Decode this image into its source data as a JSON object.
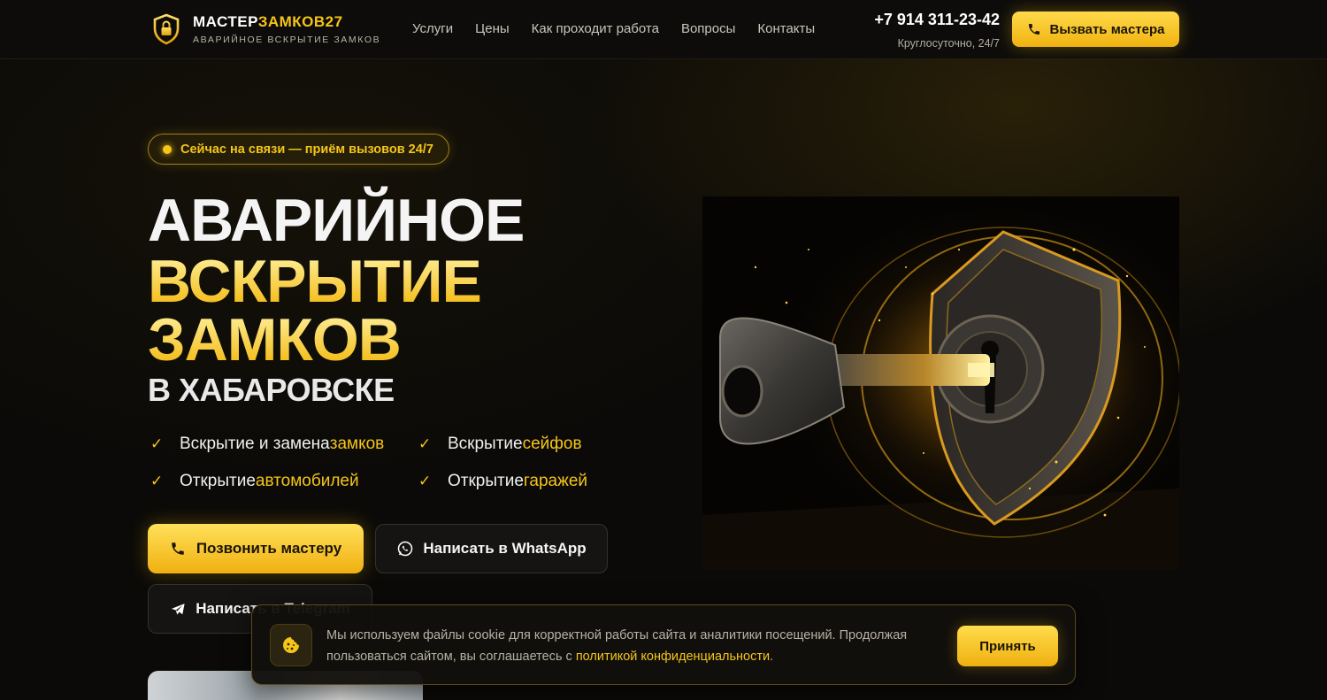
{
  "header": {
    "logo_title_part1": "МАСТЕР",
    "logo_title_part2": "ЗАМКОВ27",
    "logo_subtitle": "АВАРИЙНОЕ ВСКРЫТИЕ ЗАМКОВ",
    "nav": [
      "Услуги",
      "Цены",
      "Как проходит работа",
      "Вопросы",
      "Контакты"
    ],
    "phone": "+7 914 311-23-42",
    "phone_note": "Круглосуточно, 24/7",
    "call_button": "Вызвать мастера"
  },
  "hero": {
    "badge": "Сейчас на связи — приём вызовов 24/7",
    "title_line1": "АВАРИЙНОЕ",
    "title_line2": "ВСКРЫТИЕ",
    "title_line3": "ЗАМКОВ",
    "title_line4": "В ХАБАРОВСКЕ",
    "features": [
      {
        "text": "Вскрытие и замена ",
        "highlight": "замков"
      },
      {
        "text": "Вскрытие ",
        "highlight": "сейфов"
      },
      {
        "text": "Открытие ",
        "highlight": "автомобилей"
      },
      {
        "text": "Открытие ",
        "highlight": "гаражей"
      }
    ],
    "btn_call": "Позвонить мастеру",
    "btn_whatsapp": "Написать в WhatsApp",
    "btn_telegram": "Написать в Telegram"
  },
  "cookie": {
    "text_before": "Мы используем файлы cookie для корректной работы сайта и аналитики посещений. Продолжая пользоваться сайтом, вы соглашаетесь с ",
    "link": "политикой конфиденциальности",
    "text_after": ".",
    "accept": "Принять"
  },
  "colors": {
    "accent": "#f5c518",
    "background": "#0b0a08"
  }
}
